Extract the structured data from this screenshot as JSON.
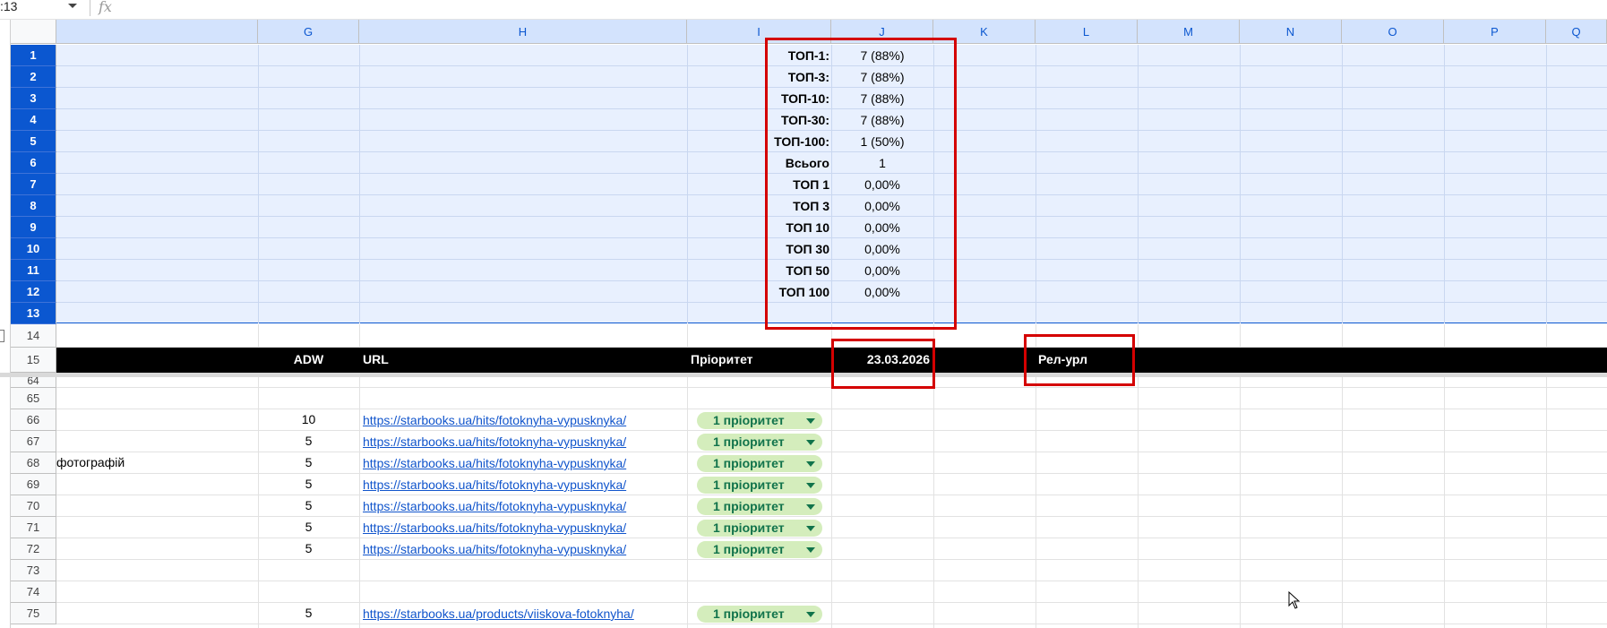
{
  "formula_bar": {
    "name_box": ":13",
    "fx_label": "fx"
  },
  "columns": [
    "G",
    "H",
    "I",
    "J",
    "K",
    "L",
    "M",
    "N",
    "O",
    "P",
    "Q"
  ],
  "top_rows": [
    "1",
    "2",
    "3",
    "4",
    "5",
    "6",
    "7",
    "8",
    "9",
    "10",
    "11",
    "12",
    "13",
    "14",
    "15"
  ],
  "bottom_rows": [
    "64",
    "65",
    "66",
    "67",
    "68",
    "69",
    "70",
    "71",
    "72",
    "73",
    "74",
    "75"
  ],
  "stats": [
    {
      "label": "ТОП-1:",
      "value": "7 (88%)"
    },
    {
      "label": "ТОП-3:",
      "value": "7 (88%)"
    },
    {
      "label": "ТОП-10:",
      "value": "7 (88%)"
    },
    {
      "label": "ТОП-30:",
      "value": "7 (88%)"
    },
    {
      "label": "ТОП-100:",
      "value": "1 (50%)"
    },
    {
      "label": "Всього",
      "value": "1"
    },
    {
      "label": "ТОП 1",
      "value": "0,00%"
    },
    {
      "label": "ТОП 3",
      "value": "0,00%"
    },
    {
      "label": "ТОП 10",
      "value": "0,00%"
    },
    {
      "label": "ТОП 30",
      "value": "0,00%"
    },
    {
      "label": "ТОП 50",
      "value": "0,00%"
    },
    {
      "label": "ТОП 100",
      "value": "0,00%"
    }
  ],
  "header_row": {
    "adw": "ADW",
    "url": "URL",
    "priority": "Пріоритет",
    "date": "23.03.2026",
    "rel_url": "Рел-урл"
  },
  "data_rows": [
    {
      "row": "66",
      "left": "",
      "adw": "10",
      "url": "https://starbooks.ua/hits/fotoknyha-vypusknyka/",
      "priority": "1 пріоритет"
    },
    {
      "row": "67",
      "left": "",
      "adw": "5",
      "url": "https://starbooks.ua/hits/fotoknyha-vypusknyka/",
      "priority": "1 пріоритет"
    },
    {
      "row": "68",
      "left": "фотографій",
      "adw": "5",
      "url": "https://starbooks.ua/hits/fotoknyha-vypusknyka/",
      "priority": "1 пріоритет"
    },
    {
      "row": "69",
      "left": "",
      "adw": "5",
      "url": "https://starbooks.ua/hits/fotoknyha-vypusknyka/",
      "priority": "1 пріоритет"
    },
    {
      "row": "70",
      "left": "",
      "adw": "5",
      "url": "https://starbooks.ua/hits/fotoknyha-vypusknyka/",
      "priority": "1 пріоритет"
    },
    {
      "row": "71",
      "left": "",
      "adw": "5",
      "url": "https://starbooks.ua/hits/fotoknyha-vypusknyka/",
      "priority": "1 пріоритет"
    },
    {
      "row": "72",
      "left": "",
      "adw": "5",
      "url": "https://starbooks.ua/hits/fotoknyha-vypusknyka/",
      "priority": "1 пріоритет"
    },
    {
      "row": "75",
      "left": "",
      "adw": "5",
      "url": "https://starbooks.ua/products/viiskova-fotoknyha/",
      "priority": "1 пріоритет"
    }
  ]
}
